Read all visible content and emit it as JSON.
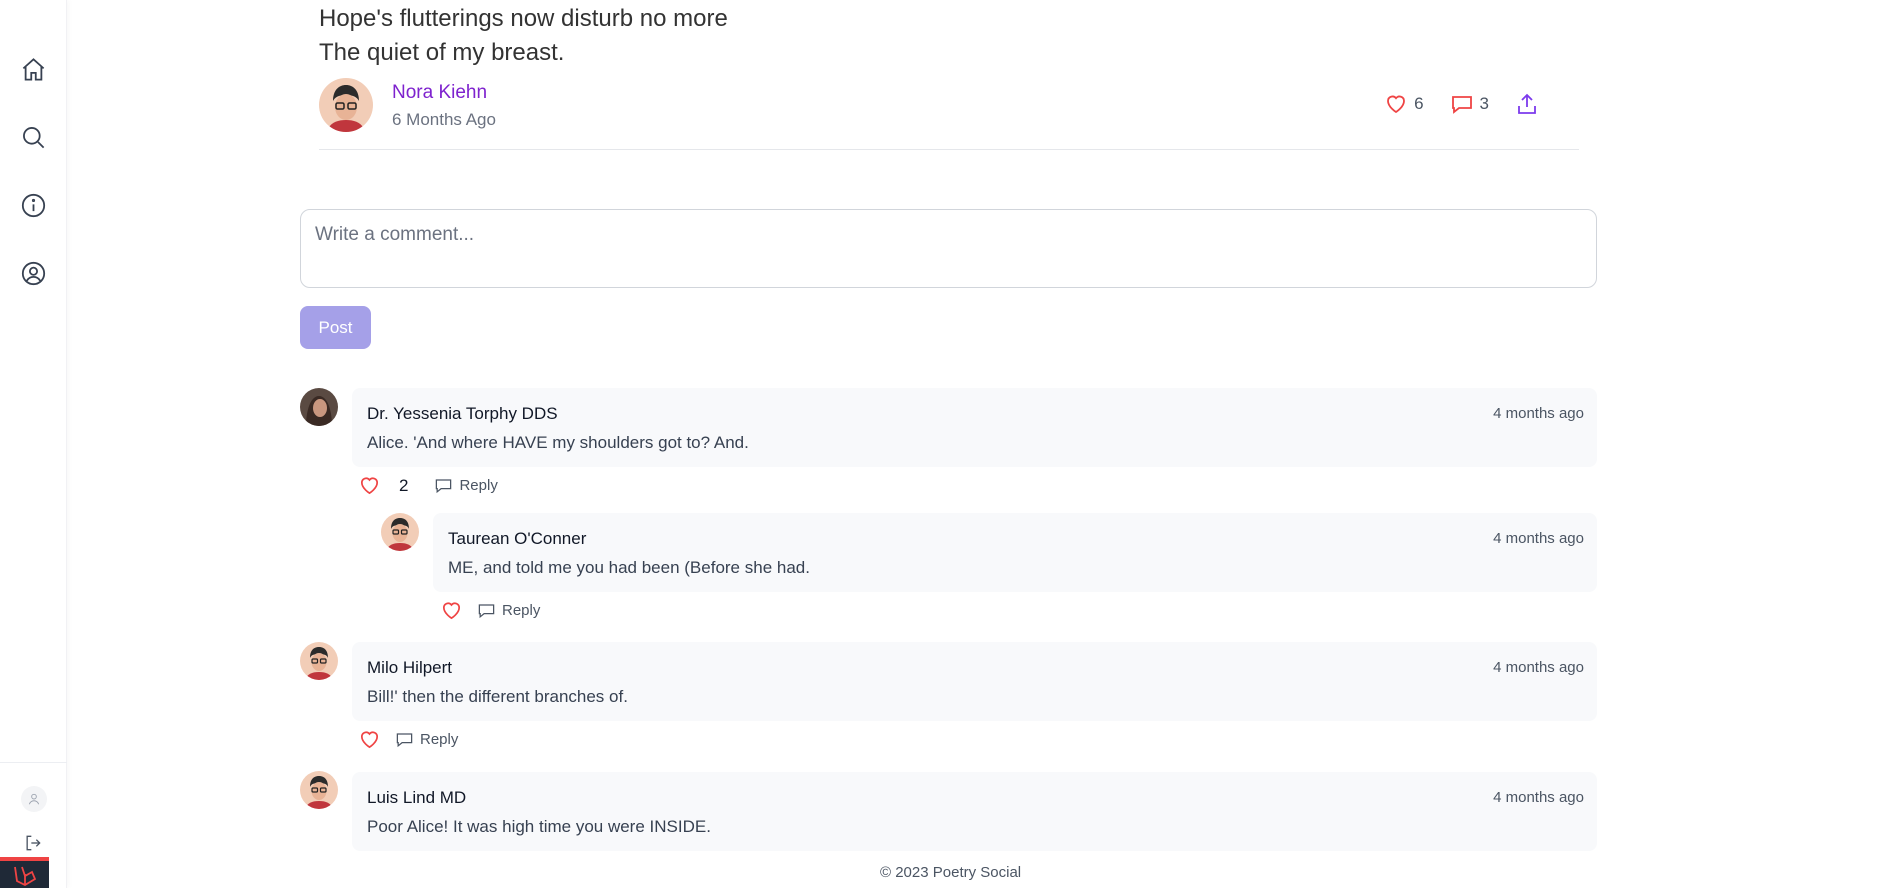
{
  "poem": {
    "line1": "Hope's flutterings now disturb no more",
    "line2": "The quiet of my breast."
  },
  "author": {
    "name": "Nora Kiehn",
    "time": "6 Months Ago",
    "likes": "6",
    "comments": "3"
  },
  "comment_form": {
    "placeholder": "Write a comment...",
    "post_label": "Post"
  },
  "comments": [
    {
      "name": "Dr. Yessenia Torphy DDS",
      "time": "4 months ago",
      "body": "Alice. 'And where HAVE my shoulders got to? And.",
      "likes": "2",
      "reply_label": "Reply",
      "replies": [
        {
          "name": "Taurean O'Conner",
          "time": "4 months ago",
          "body": "ME, and told me you had been (Before she had.",
          "reply_label": "Reply"
        }
      ]
    },
    {
      "name": "Milo Hilpert",
      "time": "4 months ago",
      "body": "Bill!' then the different branches of.",
      "reply_label": "Reply"
    },
    {
      "name": "Luis Lind MD",
      "time": "4 months ago",
      "body": "Poor Alice! It was high time you were INSIDE."
    }
  ],
  "footer": {
    "text": "© 2023 Poetry Social"
  },
  "colors": {
    "accent": "#7e22ce",
    "like": "#ef4444",
    "post_button": "#a5a0e8"
  }
}
